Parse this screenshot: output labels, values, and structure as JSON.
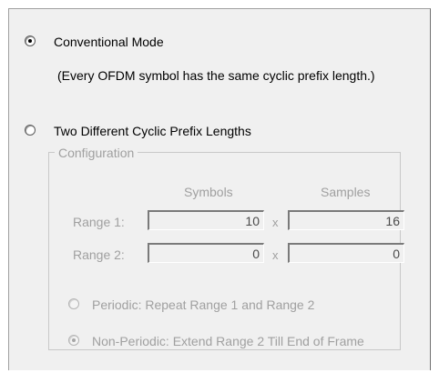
{
  "mode_options": {
    "conventional": {
      "label": "Conventional Mode",
      "description": "(Every OFDM symbol has the same cyclic prefix length.)",
      "selected": true
    },
    "two_cp": {
      "label": "Two Different Cyclic Prefix Lengths",
      "selected": false
    }
  },
  "configuration": {
    "title": "Configuration",
    "enabled": false,
    "columns": {
      "symbols": "Symbols",
      "samples": "Samples"
    },
    "multiply_sign": "x",
    "ranges": [
      {
        "label": "Range 1:",
        "symbols": "10",
        "samples": "16"
      },
      {
        "label": "Range 2:",
        "symbols": "0",
        "samples": "0"
      }
    ],
    "repeat_options": {
      "periodic": {
        "label": "Periodic: Repeat Range 1 and Range 2",
        "selected": false
      },
      "non_periodic": {
        "label": "Non-Periodic: Extend Range 2 Till End of Frame",
        "selected": true
      }
    }
  },
  "colors": {
    "panel_background": "#f0f0f0",
    "disabled_text": "#a0a0a0"
  }
}
